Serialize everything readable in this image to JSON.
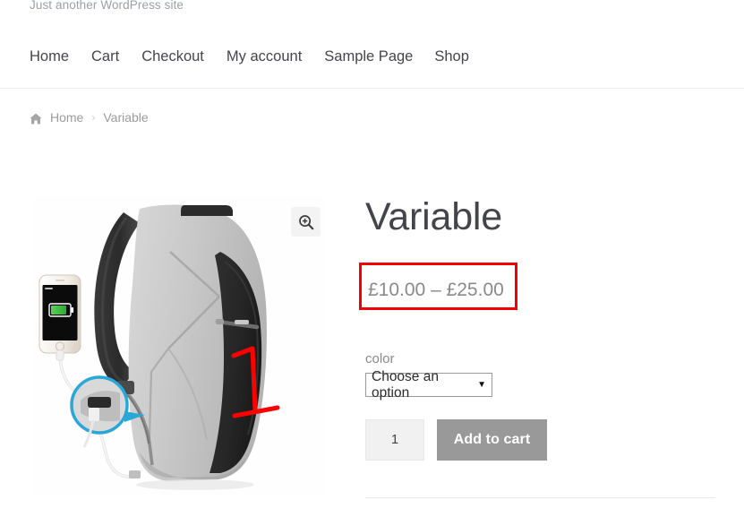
{
  "site": {
    "tagline": "Just another WordPress site"
  },
  "nav": {
    "items": [
      {
        "label": "Home",
        "name": "nav-item-home"
      },
      {
        "label": "Cart",
        "name": "nav-item-cart"
      },
      {
        "label": "Checkout",
        "name": "nav-item-checkout"
      },
      {
        "label": "My account",
        "name": "nav-item-my-account"
      },
      {
        "label": "Sample Page",
        "name": "nav-item-sample-page"
      },
      {
        "label": "Shop",
        "name": "nav-item-shop"
      }
    ]
  },
  "breadcrumb": {
    "home_icon": "home-icon",
    "home_label": "Home",
    "separator": "›",
    "current": "Variable"
  },
  "gallery": {
    "zoom_icon": "magnifier-plus-icon",
    "image_alt": "Grey and black anti-theft backpack with USB charging port, phone connected and charging, blue circular callout on the USB port, red handwritten number 1 on the front pocket"
  },
  "product": {
    "title": "Variable",
    "price": "£10.00 – £25.00",
    "price_highlight_color": "#f40000",
    "attribute": {
      "label": "color",
      "selected": "Choose an option",
      "caret": "▼",
      "options": [
        "Choose an option"
      ]
    },
    "quantity": "1",
    "add_to_cart_label": "Add to cart",
    "add_to_cart_color": "#999999"
  }
}
